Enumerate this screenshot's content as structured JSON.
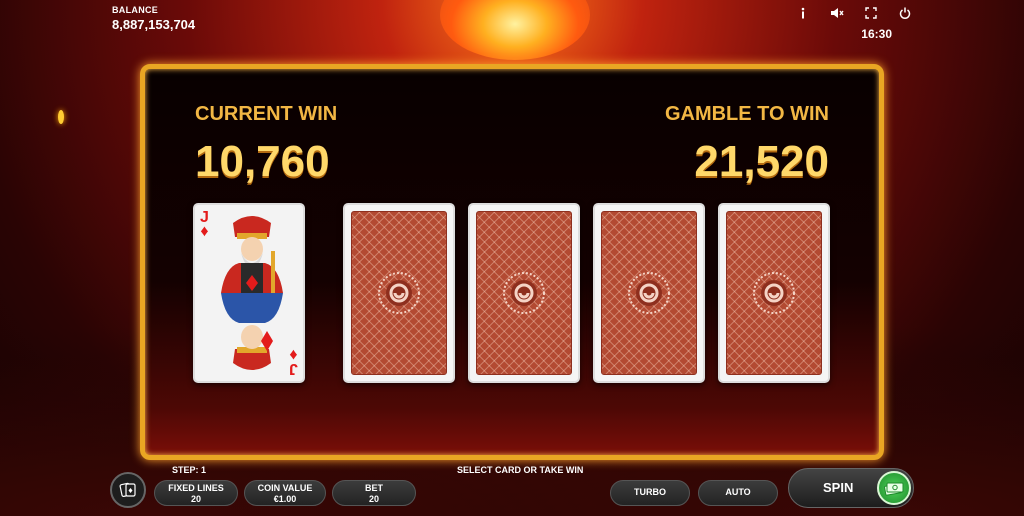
{
  "balance": {
    "label": "BALANCE",
    "value": "8,887,153,704"
  },
  "topbar": {
    "icons": [
      "info-icon",
      "mute-icon",
      "fullscreen-icon",
      "power-icon"
    ],
    "time": "16:30"
  },
  "panel": {
    "current_win_label": "CURRENT WIN",
    "current_win_value": "10,760",
    "gamble_label": "GAMBLE TO WIN",
    "gamble_value": "21,520"
  },
  "dealer_card": {
    "rank": "J",
    "suit": "♦",
    "face": "jack-of-diamonds"
  },
  "hidden_cards": 4,
  "footer": {
    "step": "STEP: 1",
    "hint": "SELECT CARD OR TAKE WIN",
    "fixed_lines_label": "FIXED LINES",
    "fixed_lines_value": "20",
    "coin_value_label": "COIN VALUE",
    "coin_value_value": "€1.00",
    "bet_label": "BET",
    "bet_value": "20",
    "turbo_label": "TURBO",
    "auto_label": "AUTO",
    "spin_label": "SPIN"
  },
  "colors": {
    "accent_gold": "#f2b744",
    "panel_border": "#e9a623",
    "card_back": "#b34a32"
  }
}
